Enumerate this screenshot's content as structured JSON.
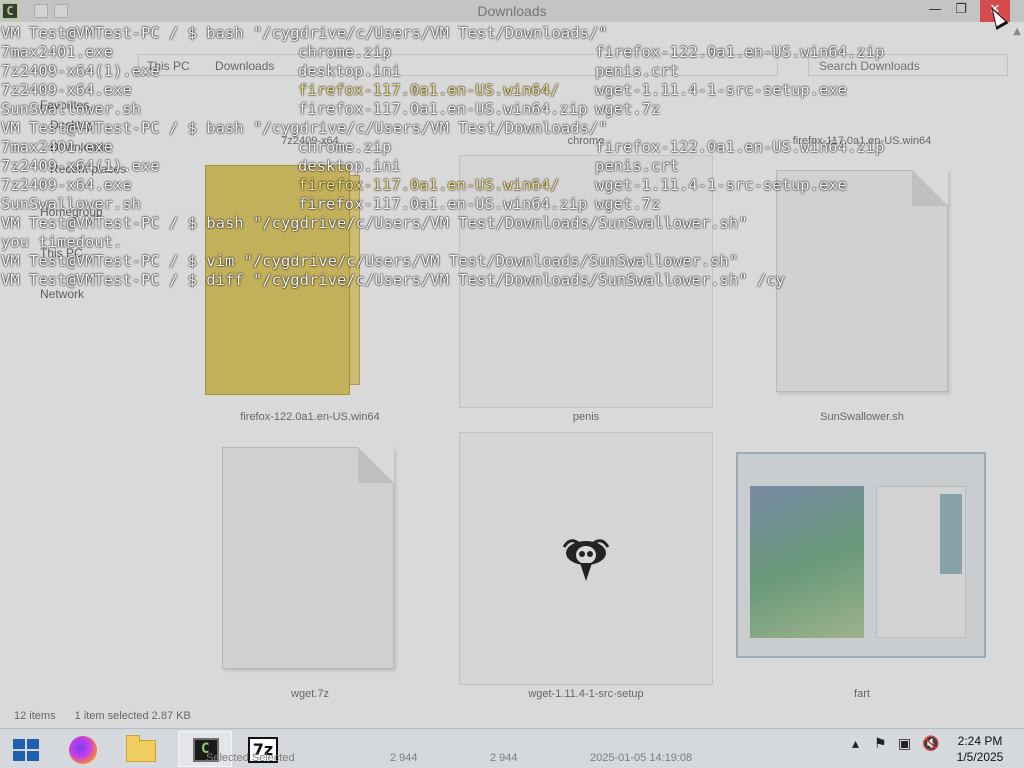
{
  "explorer": {
    "title": "Downloads",
    "breadcrumb": [
      "This PC",
      "Downloads"
    ],
    "search_placeholder": "Search Downloads",
    "nav": [
      "Favorites",
      "Desktop",
      "Downloads",
      "Recent places",
      "Homegroup",
      "This PC",
      "Network"
    ],
    "tiles": [
      {
        "label": "7z2409-x64"
      },
      {
        "label": "chrome"
      },
      {
        "label": "firefox-117.0a1.en-US.win64"
      },
      {
        "label": "firefox-122.0a1.en-US.win64"
      },
      {
        "label": "penis"
      },
      {
        "label": "SunSwallower.sh"
      },
      {
        "label": "wget.7z"
      },
      {
        "label": "wget-1.11.4-1-src-setup"
      },
      {
        "label": "fart"
      }
    ],
    "status": {
      "items": "12 items",
      "selected": "1 item selected  2.87 KB"
    }
  },
  "terminal": {
    "lines": [
      {
        "type": "cmd",
        "text": "VM Test@VMTest-PC / $ bash \"/cygdrive/c/Users/VM Test/Downloads/\""
      },
      {
        "type": "cols",
        "cols": [
          "7max2401.exe",
          "chrome.zip",
          "firefox-122.0a1.en-US.win64.zip"
        ]
      },
      {
        "type": "cols",
        "cols": [
          "7z2409-x64(1).exe",
          "desktop.ini",
          "penis.crt"
        ]
      },
      {
        "type": "cols",
        "cols": [
          "7z2409-x64.exe",
          "firefox-117.0a1.en-US.win64/",
          "wget-1.11.4-1-src-setup.exe"
        ]
      },
      {
        "type": "cols",
        "cols": [
          "SunSwallower.sh",
          "firefox-117.0a1.en-US.win64.zip",
          "wget.7z"
        ]
      },
      {
        "type": "cmd",
        "text": "VM Test@VMTest-PC / $ bash \"/cygdrive/c/Users/VM Test/Downloads/\""
      },
      {
        "type": "cols",
        "cols": [
          "7max2401.exe",
          "chrome.zip",
          "firefox-122.0a1.en-US.win64.zip"
        ]
      },
      {
        "type": "cols",
        "cols": [
          "7z2409-x64(1).exe",
          "desktop.ini",
          "penis.crt"
        ]
      },
      {
        "type": "cols",
        "cols": [
          "7z2409-x64.exe",
          "firefox-117.0a1.en-US.win64/",
          "wget-1.11.4-1-src-setup.exe"
        ]
      },
      {
        "type": "cols",
        "cols": [
          "SunSwallower.sh",
          "firefox-117.0a1.en-US.win64.zip",
          "wget.7z"
        ]
      },
      {
        "type": "cmd",
        "text": "VM Test@VMTest-PC / $ bash \"/cygdrive/c/Users/VM Test/Downloads/SunSwallower.sh\""
      },
      {
        "type": "out",
        "text": "you timedout."
      },
      {
        "type": "cmd",
        "text": "VM Test@VMTest-PC / $ vim \"/cygdrive/c/Users/VM Test/Downloads/SunSwallower.sh\""
      },
      {
        "type": "cmd",
        "text": "VM Test@VMTest-PC / $ diff \"/cygdrive/c/Users/VM Test/Downloads/SunSwallower.sh\" /cy"
      }
    ],
    "window_buttons": {
      "minimize": "—",
      "restore": "❐",
      "close": "✕"
    }
  },
  "taskbar": {
    "ghost_text": [
      "Selected Selected",
      "2 944",
      "2 944",
      "2025-01-05 14:19:08"
    ],
    "clock": {
      "time": "2:24 PM",
      "date": "1/5/2025"
    },
    "tray_icons": [
      "chevron-up-icon",
      "flag-icon",
      "network-icon",
      "speaker-muted-icon"
    ]
  }
}
